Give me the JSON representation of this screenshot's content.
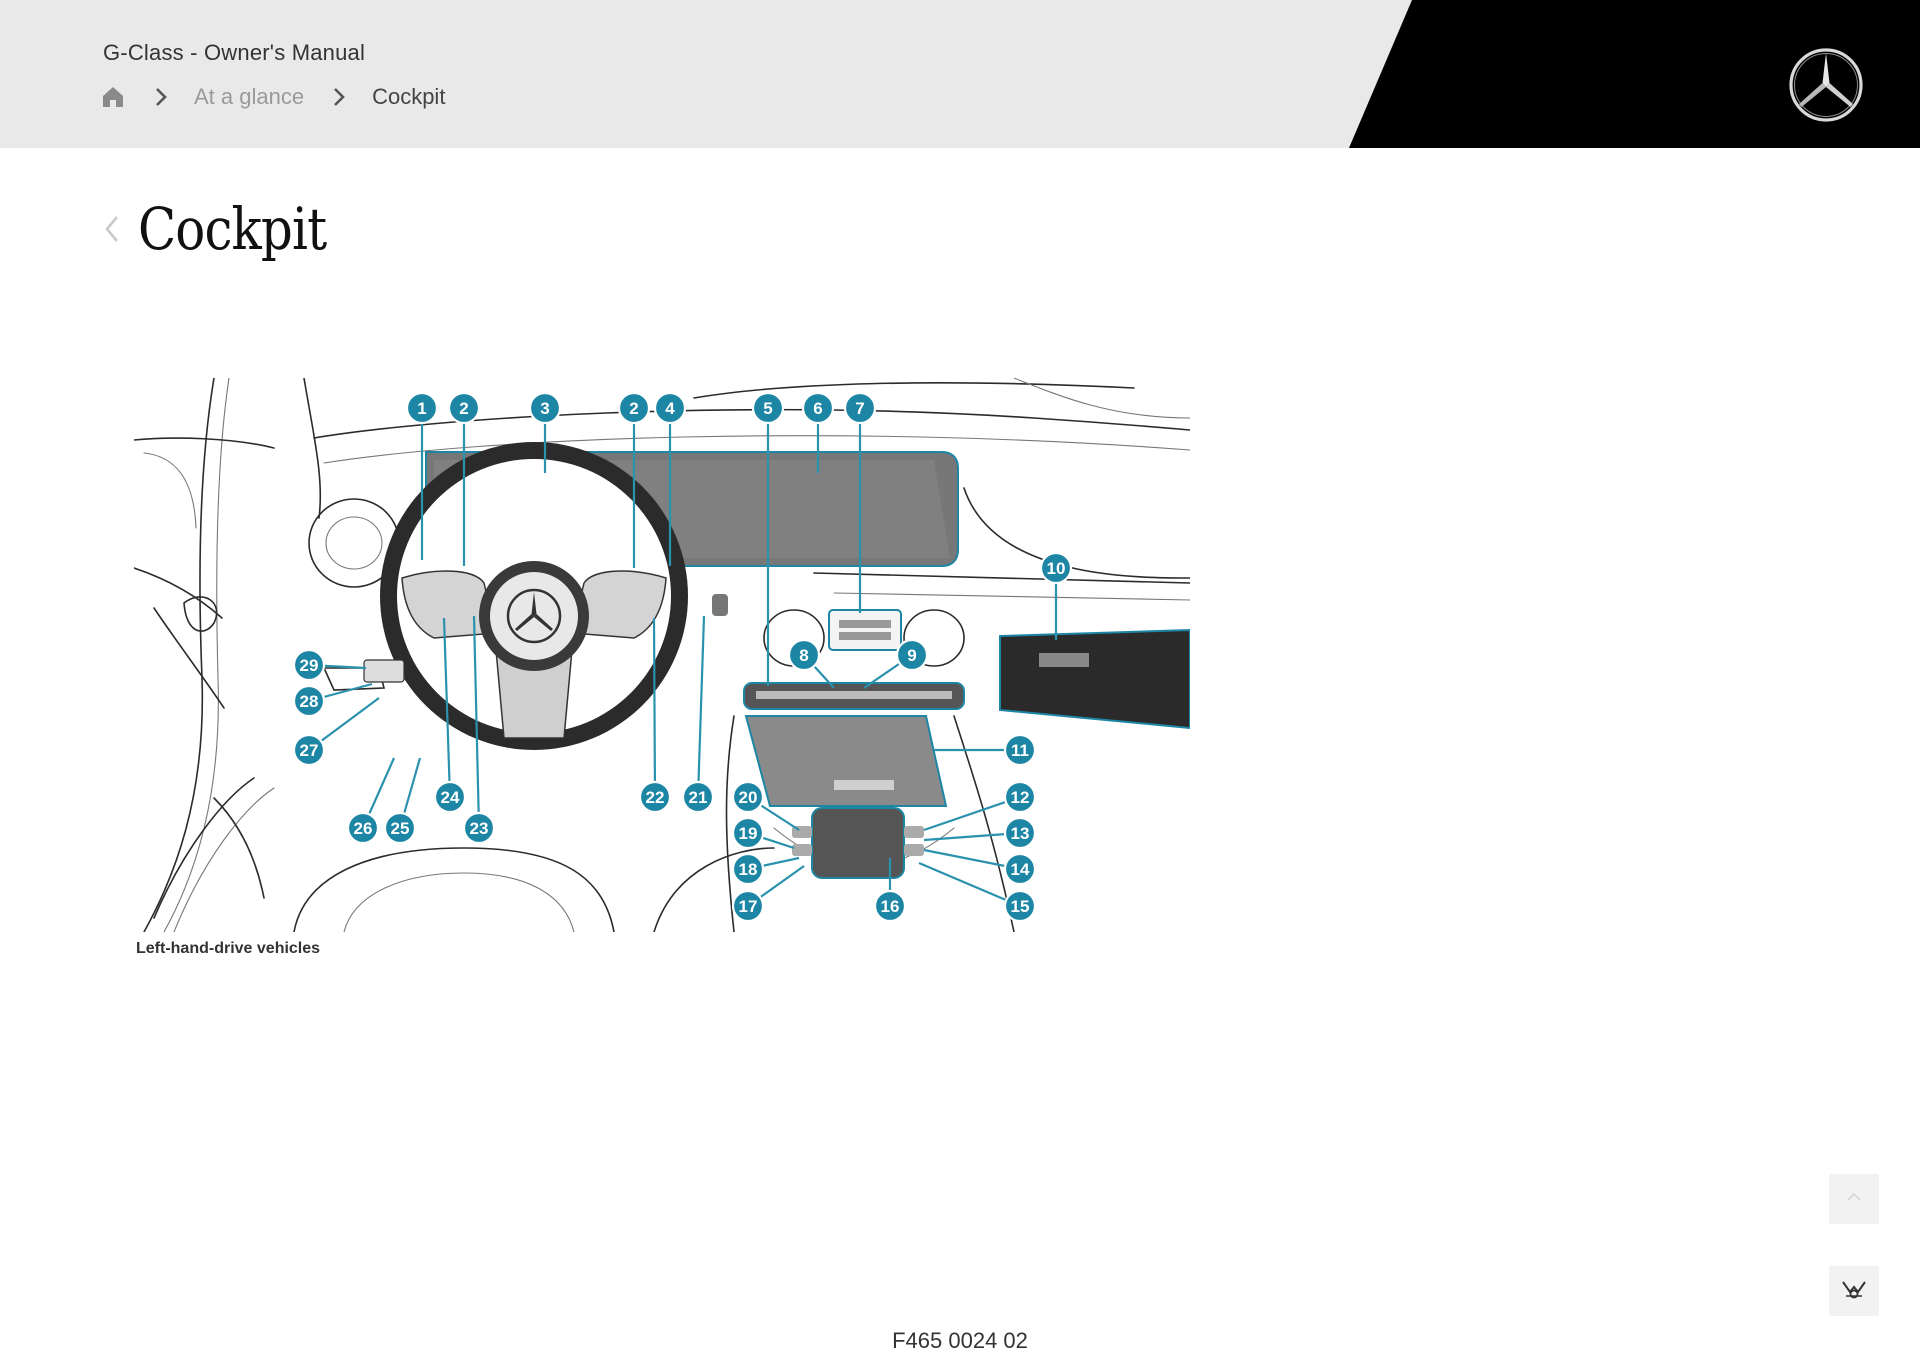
{
  "header": {
    "manual_title": "G-Class - Owner's Manual",
    "breadcrumb": [
      {
        "label": "At a glance"
      },
      {
        "label": "Cockpit"
      }
    ]
  },
  "page": {
    "title": "Cockpit"
  },
  "figure": {
    "caption": "Left-hand-drive vehicles",
    "code": "F465 0024 02",
    "callouts": [
      "1",
      "2",
      "3",
      "2",
      "4",
      "5",
      "6",
      "7",
      "8",
      "9",
      "10",
      "11",
      "12",
      "13",
      "14",
      "15",
      "16",
      "17",
      "18",
      "19",
      "20",
      "21",
      "22",
      "23",
      "24",
      "25",
      "26",
      "27",
      "28",
      "29"
    ]
  },
  "colors": {
    "header_bg": "#e9e9e9",
    "header_black": "#000000",
    "callout": "#1d86a4",
    "callout_line": "#2a92ad"
  },
  "icons": {
    "home": "home-icon",
    "breadcrumb_sep": "chevron-right-icon",
    "back": "chevron-left-icon",
    "logo": "mercedes-star-logo",
    "scroll_top": "chevron-up-icon",
    "cookie": "cookie-settings-icon"
  }
}
